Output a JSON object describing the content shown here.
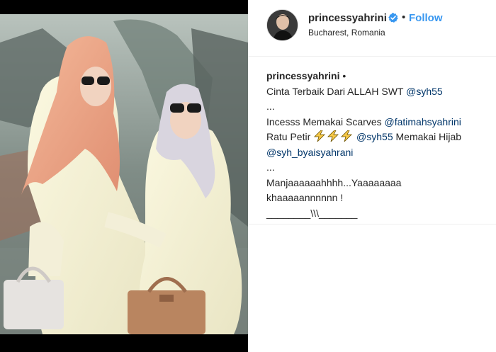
{
  "post": {
    "username": "princessyahrini",
    "follow_separator": "•",
    "follow_label": "Follow",
    "location": "Bucharest, Romania",
    "verified": true,
    "photo_description_icon": "photo"
  },
  "caption": {
    "author": "princessyahrini",
    "author_separator": "•",
    "line1_text": "Cinta Terbaik Dari ALLAH SWT ",
    "line1_mention": "@syh55",
    "line2": "...",
    "line3_text": "Incesss Memakai Scarves ",
    "line3_mention": "@fatimahsyahrini",
    "line4_text": "Ratu Petir ",
    "line4_emoji": "lightning-emoji",
    "line4_mention": "@syh55",
    "line4_tail": " Memakai Hijab",
    "line5_mention": "@syh_byaisyahrani",
    "line6": "...",
    "line7": "Manjaaaaaahhhh...Yaaaaaaaa",
    "line8": "khaaaaannnnnn !",
    "line9": "________\\\\\\_______"
  },
  "colors": {
    "link": "#3897f0",
    "mention": "#003569",
    "text": "#262626",
    "verified": "#3897f0"
  }
}
